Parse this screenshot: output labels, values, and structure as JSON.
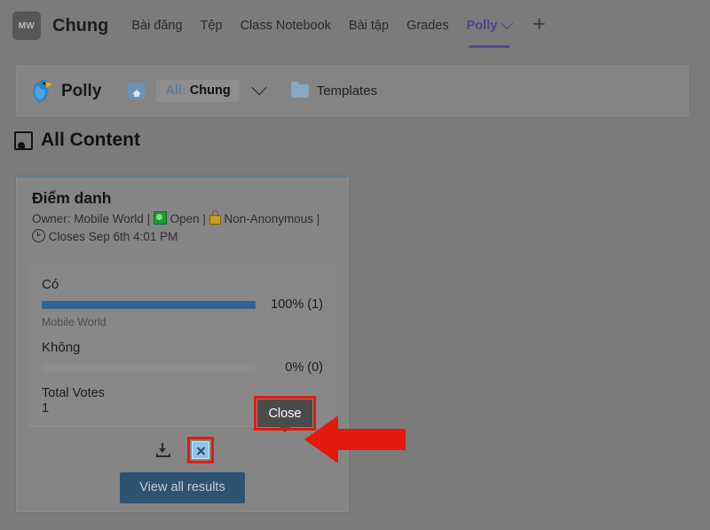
{
  "window": {
    "team_avatar_initials": "MW",
    "team_name": "Chung"
  },
  "tabs": [
    {
      "label": "Bài đăng",
      "active": false,
      "has_chevron": false
    },
    {
      "label": "Tệp",
      "active": false,
      "has_chevron": false
    },
    {
      "label": "Class Notebook",
      "active": false,
      "has_chevron": false
    },
    {
      "label": "Bài tập",
      "active": false,
      "has_chevron": false
    },
    {
      "label": "Grades",
      "active": false,
      "has_chevron": false
    },
    {
      "label": "Polly",
      "active": true,
      "has_chevron": true
    }
  ],
  "add_tab_label": "+",
  "polly_bar": {
    "app_name": "Polly",
    "home_icon": "home-icon",
    "scope_prefix": "All:",
    "scope_value": "Chung",
    "dropdown_icon": "chevron-down-icon",
    "templates_label": "Templates",
    "folder_icon": "folder-icon"
  },
  "section": {
    "icon": "all-content-icon",
    "title": "All Content"
  },
  "poll": {
    "title": "Điểm danh",
    "owner_prefix": "Owner:",
    "owner": "Mobile World",
    "sep": "|",
    "status_label": "Open",
    "status_icon": "open-status-icon",
    "anonymity_label": "Non-Anonymous",
    "anonymity_icon": "lock-icon",
    "clock_icon": "clock-icon",
    "closes_label": "Closes Sep 6th 4:01 PM",
    "options": [
      {
        "label": "Có",
        "percent_label": "100% (1)",
        "percent": 100,
        "votes": 1,
        "voters": "Mobile World"
      },
      {
        "label": "Không",
        "percent_label": "0% (0)",
        "percent": 0,
        "votes": 0,
        "voters": ""
      }
    ],
    "total_votes_label": "Total Votes",
    "total_votes": "1",
    "download_icon": "download-icon",
    "close_icon": "close-icon",
    "view_all_label": "View all results"
  },
  "annotation": {
    "tooltip_text": "Close",
    "highlight_color": "#e21b0c",
    "arrow_icon": "red-arrow-pointing-left"
  },
  "colors": {
    "page_bg": "#7b7b7b",
    "card_bg": "#858585",
    "card_top_border": "#5d7e98",
    "bar_fill": "#31638f",
    "button_bg": "#2d5272",
    "tab_active": "#4f4a92",
    "tooltip_bg": "#4b4b4b",
    "highlight": "#e21b0c"
  }
}
